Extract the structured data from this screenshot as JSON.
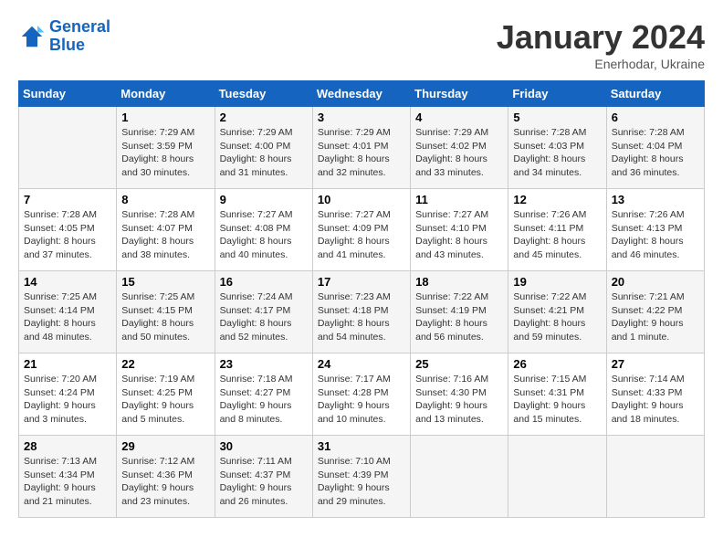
{
  "logo": {
    "line1": "General",
    "line2": "Blue"
  },
  "title": "January 2024",
  "subtitle": "Enerhodar, Ukraine",
  "headers": [
    "Sunday",
    "Monday",
    "Tuesday",
    "Wednesday",
    "Thursday",
    "Friday",
    "Saturday"
  ],
  "weeks": [
    [
      {
        "day": "",
        "sunrise": "",
        "sunset": "",
        "daylight": ""
      },
      {
        "day": "1",
        "sunrise": "Sunrise: 7:29 AM",
        "sunset": "Sunset: 3:59 PM",
        "daylight": "Daylight: 8 hours and 30 minutes."
      },
      {
        "day": "2",
        "sunrise": "Sunrise: 7:29 AM",
        "sunset": "Sunset: 4:00 PM",
        "daylight": "Daylight: 8 hours and 31 minutes."
      },
      {
        "day": "3",
        "sunrise": "Sunrise: 7:29 AM",
        "sunset": "Sunset: 4:01 PM",
        "daylight": "Daylight: 8 hours and 32 minutes."
      },
      {
        "day": "4",
        "sunrise": "Sunrise: 7:29 AM",
        "sunset": "Sunset: 4:02 PM",
        "daylight": "Daylight: 8 hours and 33 minutes."
      },
      {
        "day": "5",
        "sunrise": "Sunrise: 7:28 AM",
        "sunset": "Sunset: 4:03 PM",
        "daylight": "Daylight: 8 hours and 34 minutes."
      },
      {
        "day": "6",
        "sunrise": "Sunrise: 7:28 AM",
        "sunset": "Sunset: 4:04 PM",
        "daylight": "Daylight: 8 hours and 36 minutes."
      }
    ],
    [
      {
        "day": "7",
        "sunrise": "Sunrise: 7:28 AM",
        "sunset": "Sunset: 4:05 PM",
        "daylight": "Daylight: 8 hours and 37 minutes."
      },
      {
        "day": "8",
        "sunrise": "Sunrise: 7:28 AM",
        "sunset": "Sunset: 4:07 PM",
        "daylight": "Daylight: 8 hours and 38 minutes."
      },
      {
        "day": "9",
        "sunrise": "Sunrise: 7:27 AM",
        "sunset": "Sunset: 4:08 PM",
        "daylight": "Daylight: 8 hours and 40 minutes."
      },
      {
        "day": "10",
        "sunrise": "Sunrise: 7:27 AM",
        "sunset": "Sunset: 4:09 PM",
        "daylight": "Daylight: 8 hours and 41 minutes."
      },
      {
        "day": "11",
        "sunrise": "Sunrise: 7:27 AM",
        "sunset": "Sunset: 4:10 PM",
        "daylight": "Daylight: 8 hours and 43 minutes."
      },
      {
        "day": "12",
        "sunrise": "Sunrise: 7:26 AM",
        "sunset": "Sunset: 4:11 PM",
        "daylight": "Daylight: 8 hours and 45 minutes."
      },
      {
        "day": "13",
        "sunrise": "Sunrise: 7:26 AM",
        "sunset": "Sunset: 4:13 PM",
        "daylight": "Daylight: 8 hours and 46 minutes."
      }
    ],
    [
      {
        "day": "14",
        "sunrise": "Sunrise: 7:25 AM",
        "sunset": "Sunset: 4:14 PM",
        "daylight": "Daylight: 8 hours and 48 minutes."
      },
      {
        "day": "15",
        "sunrise": "Sunrise: 7:25 AM",
        "sunset": "Sunset: 4:15 PM",
        "daylight": "Daylight: 8 hours and 50 minutes."
      },
      {
        "day": "16",
        "sunrise": "Sunrise: 7:24 AM",
        "sunset": "Sunset: 4:17 PM",
        "daylight": "Daylight: 8 hours and 52 minutes."
      },
      {
        "day": "17",
        "sunrise": "Sunrise: 7:23 AM",
        "sunset": "Sunset: 4:18 PM",
        "daylight": "Daylight: 8 hours and 54 minutes."
      },
      {
        "day": "18",
        "sunrise": "Sunrise: 7:22 AM",
        "sunset": "Sunset: 4:19 PM",
        "daylight": "Daylight: 8 hours and 56 minutes."
      },
      {
        "day": "19",
        "sunrise": "Sunrise: 7:22 AM",
        "sunset": "Sunset: 4:21 PM",
        "daylight": "Daylight: 8 hours and 59 minutes."
      },
      {
        "day": "20",
        "sunrise": "Sunrise: 7:21 AM",
        "sunset": "Sunset: 4:22 PM",
        "daylight": "Daylight: 9 hours and 1 minute."
      }
    ],
    [
      {
        "day": "21",
        "sunrise": "Sunrise: 7:20 AM",
        "sunset": "Sunset: 4:24 PM",
        "daylight": "Daylight: 9 hours and 3 minutes."
      },
      {
        "day": "22",
        "sunrise": "Sunrise: 7:19 AM",
        "sunset": "Sunset: 4:25 PM",
        "daylight": "Daylight: 9 hours and 5 minutes."
      },
      {
        "day": "23",
        "sunrise": "Sunrise: 7:18 AM",
        "sunset": "Sunset: 4:27 PM",
        "daylight": "Daylight: 9 hours and 8 minutes."
      },
      {
        "day": "24",
        "sunrise": "Sunrise: 7:17 AM",
        "sunset": "Sunset: 4:28 PM",
        "daylight": "Daylight: 9 hours and 10 minutes."
      },
      {
        "day": "25",
        "sunrise": "Sunrise: 7:16 AM",
        "sunset": "Sunset: 4:30 PM",
        "daylight": "Daylight: 9 hours and 13 minutes."
      },
      {
        "day": "26",
        "sunrise": "Sunrise: 7:15 AM",
        "sunset": "Sunset: 4:31 PM",
        "daylight": "Daylight: 9 hours and 15 minutes."
      },
      {
        "day": "27",
        "sunrise": "Sunrise: 7:14 AM",
        "sunset": "Sunset: 4:33 PM",
        "daylight": "Daylight: 9 hours and 18 minutes."
      }
    ],
    [
      {
        "day": "28",
        "sunrise": "Sunrise: 7:13 AM",
        "sunset": "Sunset: 4:34 PM",
        "daylight": "Daylight: 9 hours and 21 minutes."
      },
      {
        "day": "29",
        "sunrise": "Sunrise: 7:12 AM",
        "sunset": "Sunset: 4:36 PM",
        "daylight": "Daylight: 9 hours and 23 minutes."
      },
      {
        "day": "30",
        "sunrise": "Sunrise: 7:11 AM",
        "sunset": "Sunset: 4:37 PM",
        "daylight": "Daylight: 9 hours and 26 minutes."
      },
      {
        "day": "31",
        "sunrise": "Sunrise: 7:10 AM",
        "sunset": "Sunset: 4:39 PM",
        "daylight": "Daylight: 9 hours and 29 minutes."
      },
      {
        "day": "",
        "sunrise": "",
        "sunset": "",
        "daylight": ""
      },
      {
        "day": "",
        "sunrise": "",
        "sunset": "",
        "daylight": ""
      },
      {
        "day": "",
        "sunrise": "",
        "sunset": "",
        "daylight": ""
      }
    ]
  ]
}
